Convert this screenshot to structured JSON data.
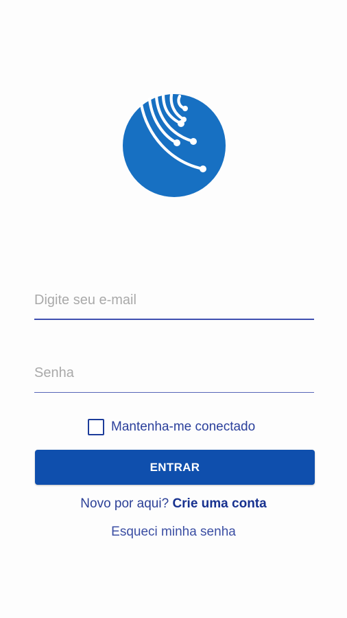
{
  "colors": {
    "brand_blue": "#1770c2",
    "button_blue": "#0f4fad",
    "text_blue": "#2b3f96",
    "underline": "#3f4fb0"
  },
  "logo": {
    "icon": "fiber-optic-logo-icon"
  },
  "login_form": {
    "email_placeholder": "Digite seu e-mail",
    "email_value": "",
    "password_placeholder": "Senha",
    "password_value": "",
    "remember_label": "Mantenha-me conectado",
    "remember_checked": false,
    "submit_label": "ENTRAR"
  },
  "signup": {
    "prompt": "Novo por aqui?",
    "link_label": "Crie uma conta"
  },
  "forgot_password": {
    "label": "Esqueci minha senha"
  }
}
